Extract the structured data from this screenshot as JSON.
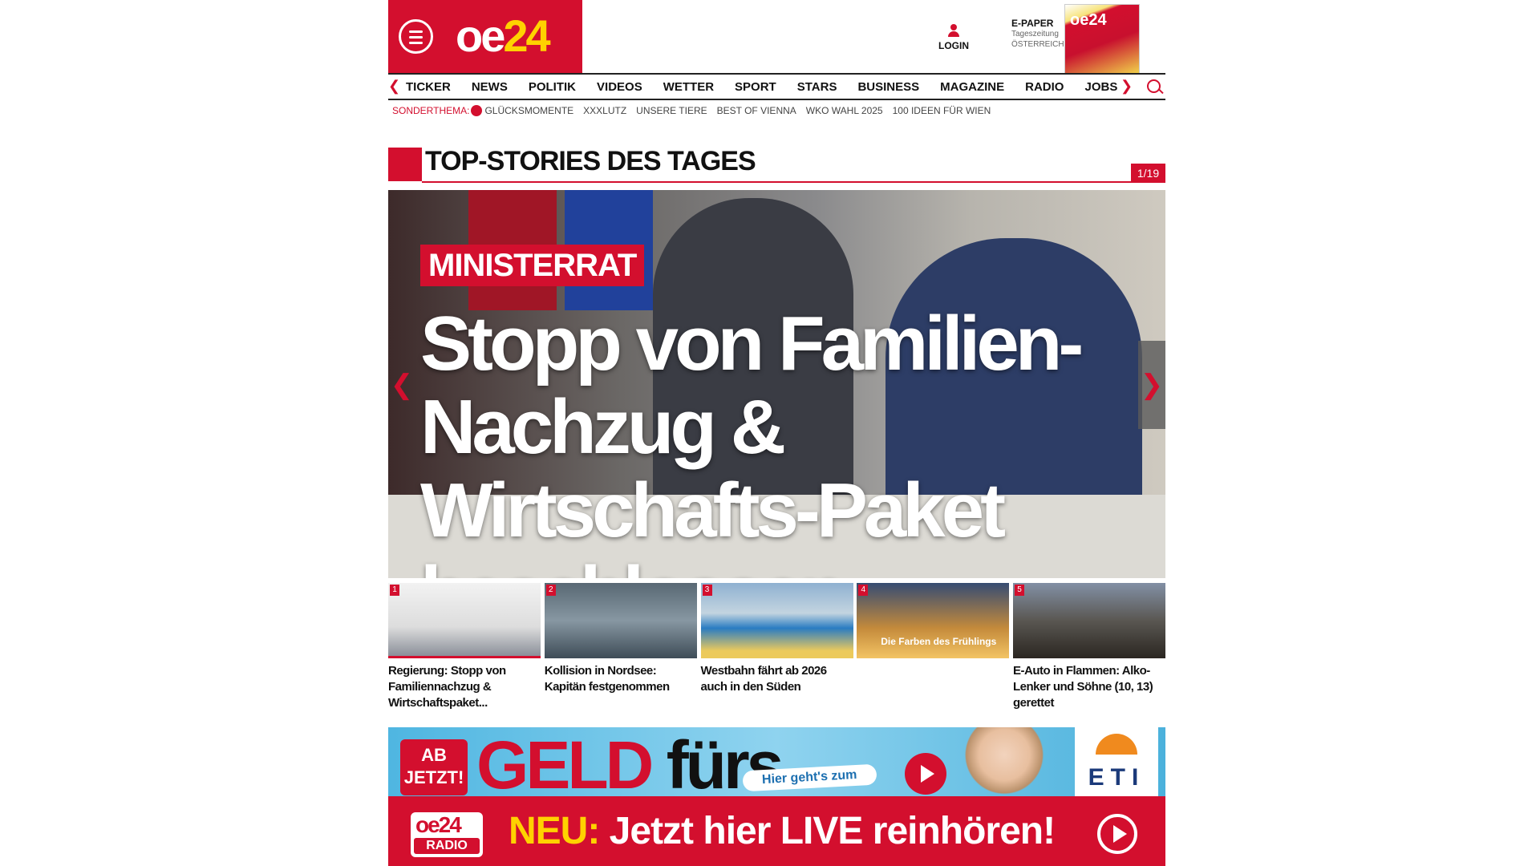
{
  "header": {
    "logo_oe": "oe",
    "logo_num": "24",
    "login_label": "LOGIN",
    "epaper_title": "E-PAPER",
    "epaper_sub1": "Tageszeitung",
    "epaper_sub2": "ÖSTERREICH",
    "epaper_cover_logo": "oe24"
  },
  "nav": {
    "items": [
      "TICKER",
      "NEWS",
      "POLITIK",
      "VIDEOS",
      "WETTER",
      "SPORT",
      "STARS",
      "BUSINESS",
      "MAGAZINE",
      "RADIO",
      "JOBS"
    ]
  },
  "subnav": {
    "label": "SONDERTHEMA:",
    "items": [
      "GLÜCKSMOMENTE",
      "XXXLUTZ",
      "UNSERE TIERE",
      "BEST OF VIENNA",
      "WKO WAHL 2025",
      "100 IDEEN FÜR WIEN"
    ]
  },
  "section": {
    "title": "TOP-STORIES DES TAGES",
    "counter": "1/19"
  },
  "hero": {
    "kicker": "MINISTERRAT",
    "headline": "Stopp von Familien-Nachzug & Wirtschafts-Paket beschlossen"
  },
  "thumbs": [
    {
      "num": "1",
      "caption": "Regierung: Stopp von Familiennachzug & Wirtschaftspaket..."
    },
    {
      "num": "2",
      "caption": "Kollision in Nordsee: Kapitän festgenommen"
    },
    {
      "num": "3",
      "caption": "Westbahn fährt ab 2026 auch in den Süden"
    },
    {
      "num": "4",
      "caption": "",
      "overlay": "Die Farben des Frühlings"
    },
    {
      "num": "5",
      "caption": "E-Auto in Flammen: Alko-Lenker und Söhne (10, 13) gerettet"
    }
  ],
  "ad": {
    "badge_line1": "AB",
    "badge_line2": "JETZT!",
    "big_text_1": "GELD",
    "big_text_2": "fürs",
    "pill": "Hier geht's zum",
    "logo_text": "ETI"
  },
  "radio": {
    "logo_oe": "oe24",
    "logo_tag": "RADIO",
    "neu": "NEU:",
    "text": "Jetzt hier LIVE reinhören!"
  },
  "colors": {
    "brand_red": "#d30f2e",
    "brand_yellow": "#ffd200"
  }
}
